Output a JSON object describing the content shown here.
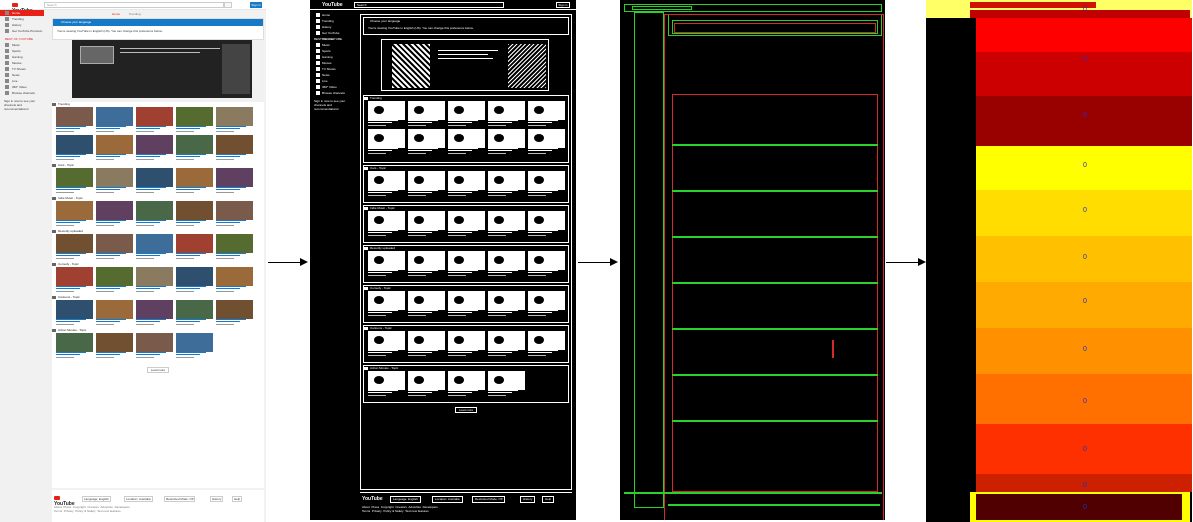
{
  "original": {
    "logo": "YouTube",
    "search_placeholder": "Search",
    "signin_label": "Sign in",
    "tabs": [
      "Home",
      "Trending"
    ],
    "sidebar_items": [
      "Home",
      "Trending",
      "History",
      "Get YouTube Premium"
    ],
    "sidebar_heading": "BEST OF YOUTUBE",
    "sidebar_categories": [
      "Music",
      "Sports",
      "Gaming",
      "Movies",
      "TV Shows",
      "News",
      "Live",
      "360° Video"
    ],
    "sidebar_browse": "Browse channels",
    "signin_prompt": "Sign in now to see your channels and recommendations!",
    "lang_header": "Choose your language",
    "lang_text": "You're viewing YouTube in English (US). You can change this preference below.",
    "shelves": [
      "Trending",
      "Cars - Topic",
      "Indie Music - Topic",
      "Recently uploaded",
      "Comedy - Topic",
      "Cartoons - Topic",
      "Action Movies - Topic"
    ],
    "load_more": "Load more",
    "footer_buttons": [
      "Language: English",
      "Location: Australia",
      "Restricted Mode: Off",
      "History",
      "Help"
    ],
    "footer_links": [
      "About",
      "Press",
      "Copyright",
      "Creators",
      "Advertise",
      "Developers",
      "Terms",
      "Privacy",
      "Policy & Safety",
      "Test new features"
    ]
  },
  "colors": {
    "youtube_red": "#e62117",
    "link_blue": "#167ac6",
    "box_green": "#2bd12b",
    "box_red": "#d12b2b",
    "label_blue": "#2030c8"
  },
  "heatmap": {
    "labels": [
      "0",
      "0",
      "0",
      "0",
      "0",
      "0",
      "0",
      "0",
      "0",
      "0",
      "0",
      "0"
    ]
  }
}
